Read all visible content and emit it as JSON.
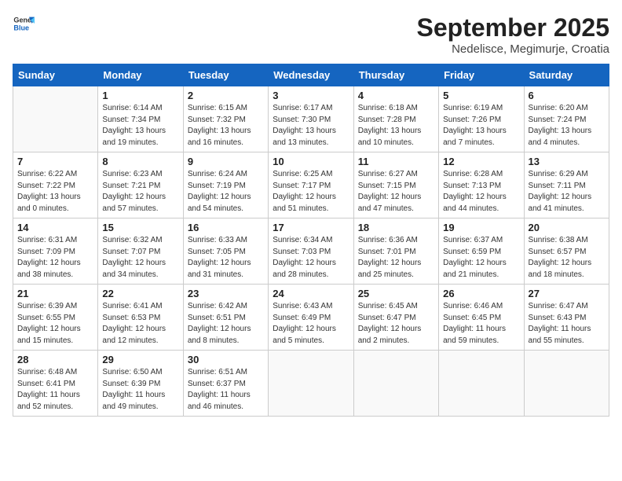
{
  "header": {
    "logo_general": "General",
    "logo_blue": "Blue",
    "title": "September 2025",
    "subtitle": "Nedelisce, Megimurje, Croatia"
  },
  "days_of_week": [
    "Sunday",
    "Monday",
    "Tuesday",
    "Wednesday",
    "Thursday",
    "Friday",
    "Saturday"
  ],
  "weeks": [
    [
      {
        "day": "",
        "info": ""
      },
      {
        "day": "1",
        "info": "Sunrise: 6:14 AM\nSunset: 7:34 PM\nDaylight: 13 hours\nand 19 minutes."
      },
      {
        "day": "2",
        "info": "Sunrise: 6:15 AM\nSunset: 7:32 PM\nDaylight: 13 hours\nand 16 minutes."
      },
      {
        "day": "3",
        "info": "Sunrise: 6:17 AM\nSunset: 7:30 PM\nDaylight: 13 hours\nand 13 minutes."
      },
      {
        "day": "4",
        "info": "Sunrise: 6:18 AM\nSunset: 7:28 PM\nDaylight: 13 hours\nand 10 minutes."
      },
      {
        "day": "5",
        "info": "Sunrise: 6:19 AM\nSunset: 7:26 PM\nDaylight: 13 hours\nand 7 minutes."
      },
      {
        "day": "6",
        "info": "Sunrise: 6:20 AM\nSunset: 7:24 PM\nDaylight: 13 hours\nand 4 minutes."
      }
    ],
    [
      {
        "day": "7",
        "info": "Sunrise: 6:22 AM\nSunset: 7:22 PM\nDaylight: 13 hours\nand 0 minutes."
      },
      {
        "day": "8",
        "info": "Sunrise: 6:23 AM\nSunset: 7:21 PM\nDaylight: 12 hours\nand 57 minutes."
      },
      {
        "day": "9",
        "info": "Sunrise: 6:24 AM\nSunset: 7:19 PM\nDaylight: 12 hours\nand 54 minutes."
      },
      {
        "day": "10",
        "info": "Sunrise: 6:25 AM\nSunset: 7:17 PM\nDaylight: 12 hours\nand 51 minutes."
      },
      {
        "day": "11",
        "info": "Sunrise: 6:27 AM\nSunset: 7:15 PM\nDaylight: 12 hours\nand 47 minutes."
      },
      {
        "day": "12",
        "info": "Sunrise: 6:28 AM\nSunset: 7:13 PM\nDaylight: 12 hours\nand 44 minutes."
      },
      {
        "day": "13",
        "info": "Sunrise: 6:29 AM\nSunset: 7:11 PM\nDaylight: 12 hours\nand 41 minutes."
      }
    ],
    [
      {
        "day": "14",
        "info": "Sunrise: 6:31 AM\nSunset: 7:09 PM\nDaylight: 12 hours\nand 38 minutes."
      },
      {
        "day": "15",
        "info": "Sunrise: 6:32 AM\nSunset: 7:07 PM\nDaylight: 12 hours\nand 34 minutes."
      },
      {
        "day": "16",
        "info": "Sunrise: 6:33 AM\nSunset: 7:05 PM\nDaylight: 12 hours\nand 31 minutes."
      },
      {
        "day": "17",
        "info": "Sunrise: 6:34 AM\nSunset: 7:03 PM\nDaylight: 12 hours\nand 28 minutes."
      },
      {
        "day": "18",
        "info": "Sunrise: 6:36 AM\nSunset: 7:01 PM\nDaylight: 12 hours\nand 25 minutes."
      },
      {
        "day": "19",
        "info": "Sunrise: 6:37 AM\nSunset: 6:59 PM\nDaylight: 12 hours\nand 21 minutes."
      },
      {
        "day": "20",
        "info": "Sunrise: 6:38 AM\nSunset: 6:57 PM\nDaylight: 12 hours\nand 18 minutes."
      }
    ],
    [
      {
        "day": "21",
        "info": "Sunrise: 6:39 AM\nSunset: 6:55 PM\nDaylight: 12 hours\nand 15 minutes."
      },
      {
        "day": "22",
        "info": "Sunrise: 6:41 AM\nSunset: 6:53 PM\nDaylight: 12 hours\nand 12 minutes."
      },
      {
        "day": "23",
        "info": "Sunrise: 6:42 AM\nSunset: 6:51 PM\nDaylight: 12 hours\nand 8 minutes."
      },
      {
        "day": "24",
        "info": "Sunrise: 6:43 AM\nSunset: 6:49 PM\nDaylight: 12 hours\nand 5 minutes."
      },
      {
        "day": "25",
        "info": "Sunrise: 6:45 AM\nSunset: 6:47 PM\nDaylight: 12 hours\nand 2 minutes."
      },
      {
        "day": "26",
        "info": "Sunrise: 6:46 AM\nSunset: 6:45 PM\nDaylight: 11 hours\nand 59 minutes."
      },
      {
        "day": "27",
        "info": "Sunrise: 6:47 AM\nSunset: 6:43 PM\nDaylight: 11 hours\nand 55 minutes."
      }
    ],
    [
      {
        "day": "28",
        "info": "Sunrise: 6:48 AM\nSunset: 6:41 PM\nDaylight: 11 hours\nand 52 minutes."
      },
      {
        "day": "29",
        "info": "Sunrise: 6:50 AM\nSunset: 6:39 PM\nDaylight: 11 hours\nand 49 minutes."
      },
      {
        "day": "30",
        "info": "Sunrise: 6:51 AM\nSunset: 6:37 PM\nDaylight: 11 hours\nand 46 minutes."
      },
      {
        "day": "",
        "info": ""
      },
      {
        "day": "",
        "info": ""
      },
      {
        "day": "",
        "info": ""
      },
      {
        "day": "",
        "info": ""
      }
    ]
  ]
}
